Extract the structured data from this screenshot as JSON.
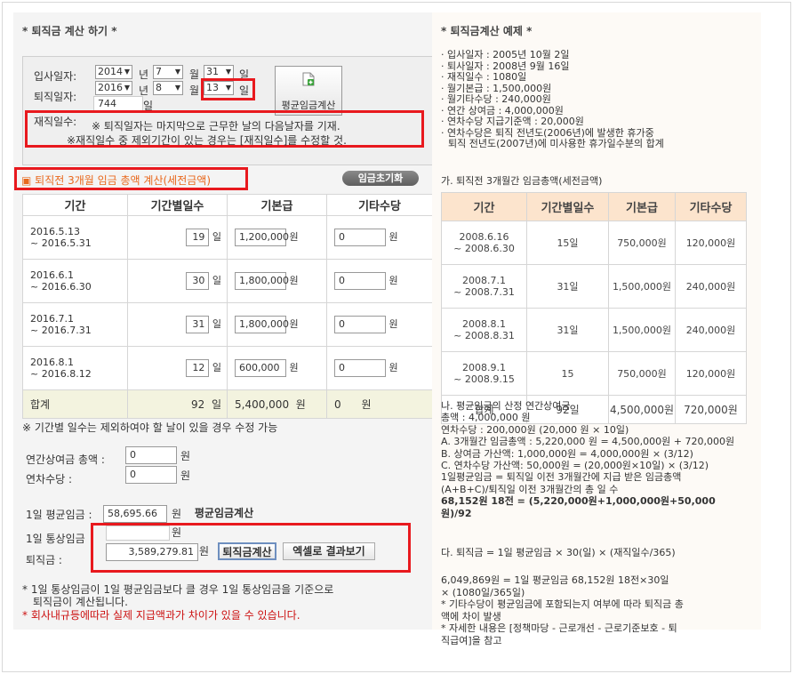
{
  "left": {
    "title": "* 퇴직금 계산 하기 *",
    "form": {
      "entry_label": "입사일자:",
      "exit_label": "퇴직일자:",
      "entry": {
        "year": "2014",
        "month": "7",
        "day": "31"
      },
      "exit": {
        "year": "2016",
        "month": "8",
        "day": "13"
      },
      "unit_year": "년",
      "unit_month": "월",
      "unit_day": "일",
      "work_days_value": "744",
      "avg_button": "평균임금계산",
      "work_days_label": "재직일수:",
      "note1": "※ 퇴직일자는 마지막으로 근무한 날의 다음날자를 기재.",
      "note2": "※재직일수 중 제외기간이 있는 경우는 [재직일수]를 수정할 것."
    },
    "section_title": "▣ 퇴직전 3개월 임금 총액 계산(세전금액)",
    "reset_button": "임금초기화",
    "table": {
      "headers": [
        "기간",
        "기간별일수",
        "기본급",
        "기타수당"
      ],
      "rows": [
        {
          "p1": "2016.5.13",
          "p2": "~ 2016.5.31",
          "days": "19",
          "base": "1,200,000",
          "other": "0"
        },
        {
          "p1": "2016.6.1",
          "p2": "~ 2016.6.30",
          "days": "30",
          "base": "1,800,000",
          "other": "0"
        },
        {
          "p1": "2016.7.1",
          "p2": "~ 2016.7.31",
          "days": "31",
          "base": "1,800,000",
          "other": "0"
        },
        {
          "p1": "2016.8.1",
          "p2": "~ 2016.8.12",
          "days": "12",
          "base": "600,000",
          "other": "0"
        }
      ],
      "sum": {
        "label": "합계",
        "days": "92",
        "base": "5,400,000",
        "other": "0"
      },
      "unit_day": "일",
      "unit_won": "원"
    },
    "period_note": "※ 기간별 일수는 제외하여야 할 날이 있을 경우 수정 가능",
    "bonus_label": "연간상여금 총액 :",
    "bonus_value": "0",
    "leave_label": "연차수당 :",
    "leave_value": "0",
    "unit_won": "원",
    "daily_avg_label": "1일 평균임금 :",
    "daily_avg_value": "58,695.66",
    "daily_avg_button": "평균임금계산",
    "daily_ord_label": "1일 통상임금",
    "daily_ord_value": "",
    "severance_label": "퇴직금 :",
    "severance_value": "3,589,279.81",
    "severance_button": "퇴직금계산",
    "excel_button": "엑셀로 결과보기",
    "bottom1": "* 1일 통상임금이 1일 평균임금보다 클 경우 1일 통상임금을 기준으로",
    "bottom2": "퇴직금이 계산됩니다.",
    "bottom3": "* 회사내규등에따라 실제 지급액과가 차이가 있을 수 있습니다."
  },
  "right": {
    "title": "* 퇴직금계산 예제 *",
    "facts": [
      "· 입사일자 : 2005년 10월 2일",
      "· 퇴사일자 : 2008년 9월 16일",
      "· 재직일수 : 1080일",
      "· 월기본급 : 1,500,000원",
      "· 월기타수당 : 240,000원",
      "· 연간 상여금 : 4,000,000원",
      "· 연차수당 지급기준액 : 20,000원",
      "· 연차수당은 퇴직 전년도(2006년)에 발생한 휴가중",
      "  퇴직 전년도(2007년)에 미사용한 휴가일수분의 합계"
    ],
    "section_a": "가. 퇴직전 3개월간 임금총액(세전금액)",
    "table": {
      "headers": [
        "기간",
        "기간별일수",
        "기본급",
        "기타수당"
      ],
      "rows": [
        {
          "p1": "2008.6.16",
          "p2": "~ 2008.6.30",
          "days": "15일",
          "base": "750,000원",
          "other": "120,000원"
        },
        {
          "p1": "2008.7.1",
          "p2": "~ 2008.7.31",
          "days": "31일",
          "base": "1,500,000원",
          "other": "240,000원"
        },
        {
          "p1": "2008.8.1",
          "p2": "~ 2008.8.31",
          "days": "31일",
          "base": "1,500,000원",
          "other": "240,000원"
        },
        {
          "p1": "2008.9.1",
          "p2": "~ 2008.9.15",
          "days": "15",
          "base": "750,000원",
          "other": "120,000원"
        }
      ],
      "sum": {
        "label": "합계",
        "days": "92일",
        "base": "4,500,000원",
        "other": "720,000원"
      }
    },
    "section_b": [
      "나. 평균임금의 산정 연간상여금",
      "총액 : 4,000,000 원",
      "연차수당 : 200,000원 (20,000 원 × 10일)",
      "A. 3개월간 임금총액 : 5,220,000 원 = 4,500,000원 + 720,000원",
      "B. 상여금 가산액: 1,000,000원 = 4,000,000원 × (3/12)",
      "C. 연차수당 가산액: 50,000원 = (20,000원×10일) × (3/12)",
      "1일평균임금 = 퇴직일 이전 3개월간에 지급 받은 임금총액",
      "(A+B+C)/퇴직일 이전 3개월간의 총 일 수"
    ],
    "formula_bold": [
      "68,152원 18전 = (5,220,000원+1,000,000원+50,000",
      "원)/92"
    ],
    "section_c": "다. 퇴직금 = 1일 평균임금 × 30(일) × (재직일수/365)",
    "result": [
      "6,049,869원 = 1일 평균임금 68,152원 18전×30일",
      "  × (1080일/365일)",
      "* 기타수당이 평균임금에 포함되는지 여부에 따라 퇴직금 총",
      "액에 차이 발생",
      "* 자세한 내용은 [정책마당 - 근로개선 - 근로기준보호 - 퇴",
      "직급여]을 참고"
    ]
  },
  "colors": {
    "highlight": "#e8191e",
    "orange": "#e8691e",
    "notice": "#cc1111",
    "sumrow": "#f3f3df",
    "header_peach": "#fce4cd"
  }
}
